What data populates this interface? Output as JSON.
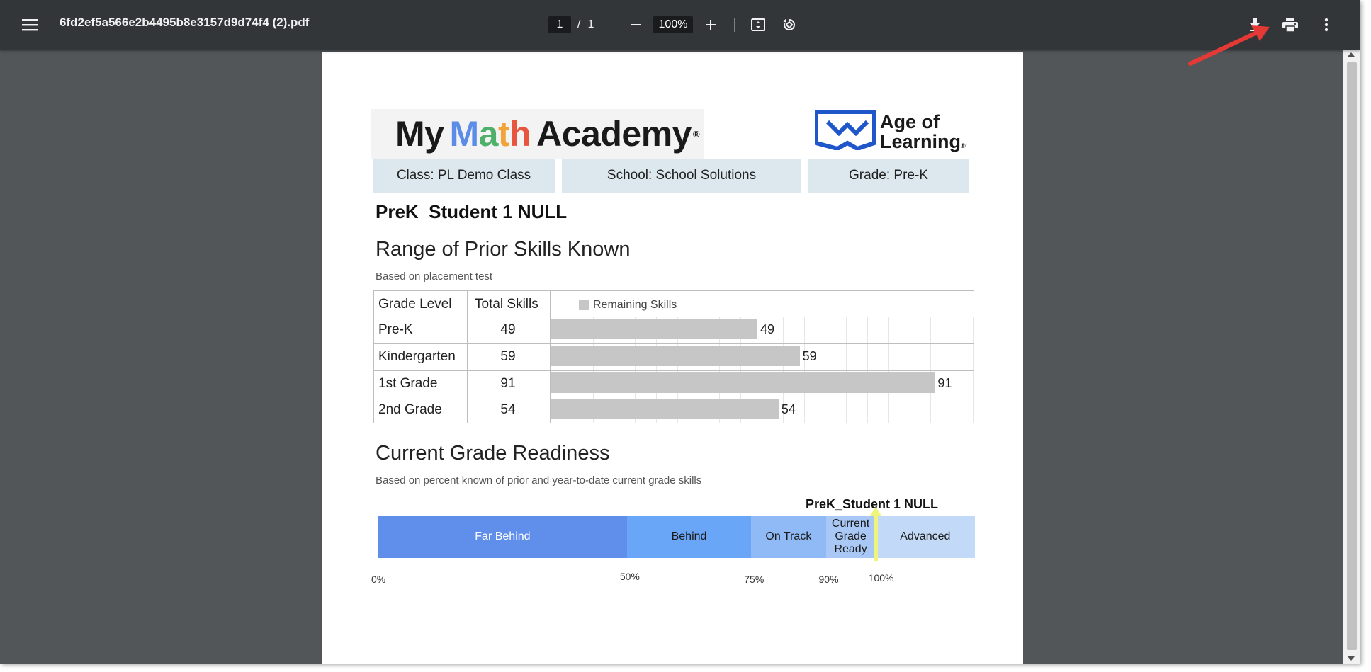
{
  "toolbar": {
    "file_name": "6fd2ef5a566e2b4495b8e3157d9d74f4 (2).pdf",
    "current_page": "1",
    "page_separator": "/",
    "total_pages": "1",
    "zoom": "100%",
    "icons": [
      "menu-icon",
      "zoom-out-icon",
      "zoom-in-icon",
      "fit-page-icon",
      "rotate-icon",
      "download-icon",
      "print-icon",
      "more-vert-icon"
    ]
  },
  "colors": {
    "toolbar_bg": "#323639",
    "viewer_bg": "#525659",
    "annotation_arrow": "#e53935",
    "highlight_marker": "#eef57a"
  },
  "document": {
    "logo_text": [
      "My",
      "Math",
      "Academy",
      "®"
    ],
    "logo_math_letters": [
      "M",
      "a",
      "t",
      "h"
    ],
    "aol_logo_lines": [
      "Age of",
      "Learning",
      "®"
    ],
    "class_info": "Class: PL Demo Class",
    "school_info": "School: School Solutions",
    "grade_info": "Grade: Pre-K",
    "student_name": "PreK_Student 1 NULL",
    "section1_title": "Range of Prior Skills Known",
    "section1_subtitle": "Based on placement test",
    "table_headers": {
      "grade_level": "Grade Level",
      "total_skills": "Total Skills",
      "legend": "Remaining Skills"
    },
    "section2_title": "Current Grade Readiness",
    "section2_subtitle": "Based on percent known of prior and year-to-date current grade skills",
    "readiness_marker_label": "PreK_Student 1 NULL"
  },
  "chart_data": [
    {
      "type": "bar",
      "orientation": "horizontal",
      "categories": [
        "Pre-K",
        "Kindergarten",
        "1st Grade",
        "2nd Grade"
      ],
      "totals": [
        "49",
        "59",
        "91",
        "54"
      ],
      "series": [
        {
          "name": "Remaining Skills",
          "values": [
            49,
            59,
            91,
            54
          ],
          "color": "#c6c6c6"
        }
      ],
      "xlim": [
        0,
        100
      ],
      "grid": true,
      "legend": "top-left"
    },
    {
      "type": "bar",
      "orientation": "horizontal-stacked-scale",
      "segments": [
        {
          "label": "Far Behind",
          "from": 0,
          "to": 50,
          "color": "#5f8fea",
          "text_color": "#ffffff"
        },
        {
          "label": "Behind",
          "from": 50,
          "to": 75,
          "color": "#6aa6f7",
          "text_color": "#1a1a1a"
        },
        {
          "label": "On Track",
          "from": 75,
          "to": 90,
          "color": "#8fbaf5",
          "text_color": "#1a1a1a"
        },
        {
          "label": "Current Grade Ready",
          "label_lines": [
            "Current",
            "Grade",
            "Ready"
          ],
          "from": 90,
          "to": 100,
          "color": "#a9c8f5",
          "text_color": "#1a1a1a"
        },
        {
          "label": "Advanced",
          "from": 100,
          "to": 120,
          "color": "#c2daf7",
          "text_color": "#1a1a1a"
        }
      ],
      "ticks": [
        "0%",
        "50%",
        "75%",
        "90%",
        "100%"
      ],
      "marker": {
        "label": "PreK_Student 1 NULL",
        "value": 100
      }
    }
  ]
}
